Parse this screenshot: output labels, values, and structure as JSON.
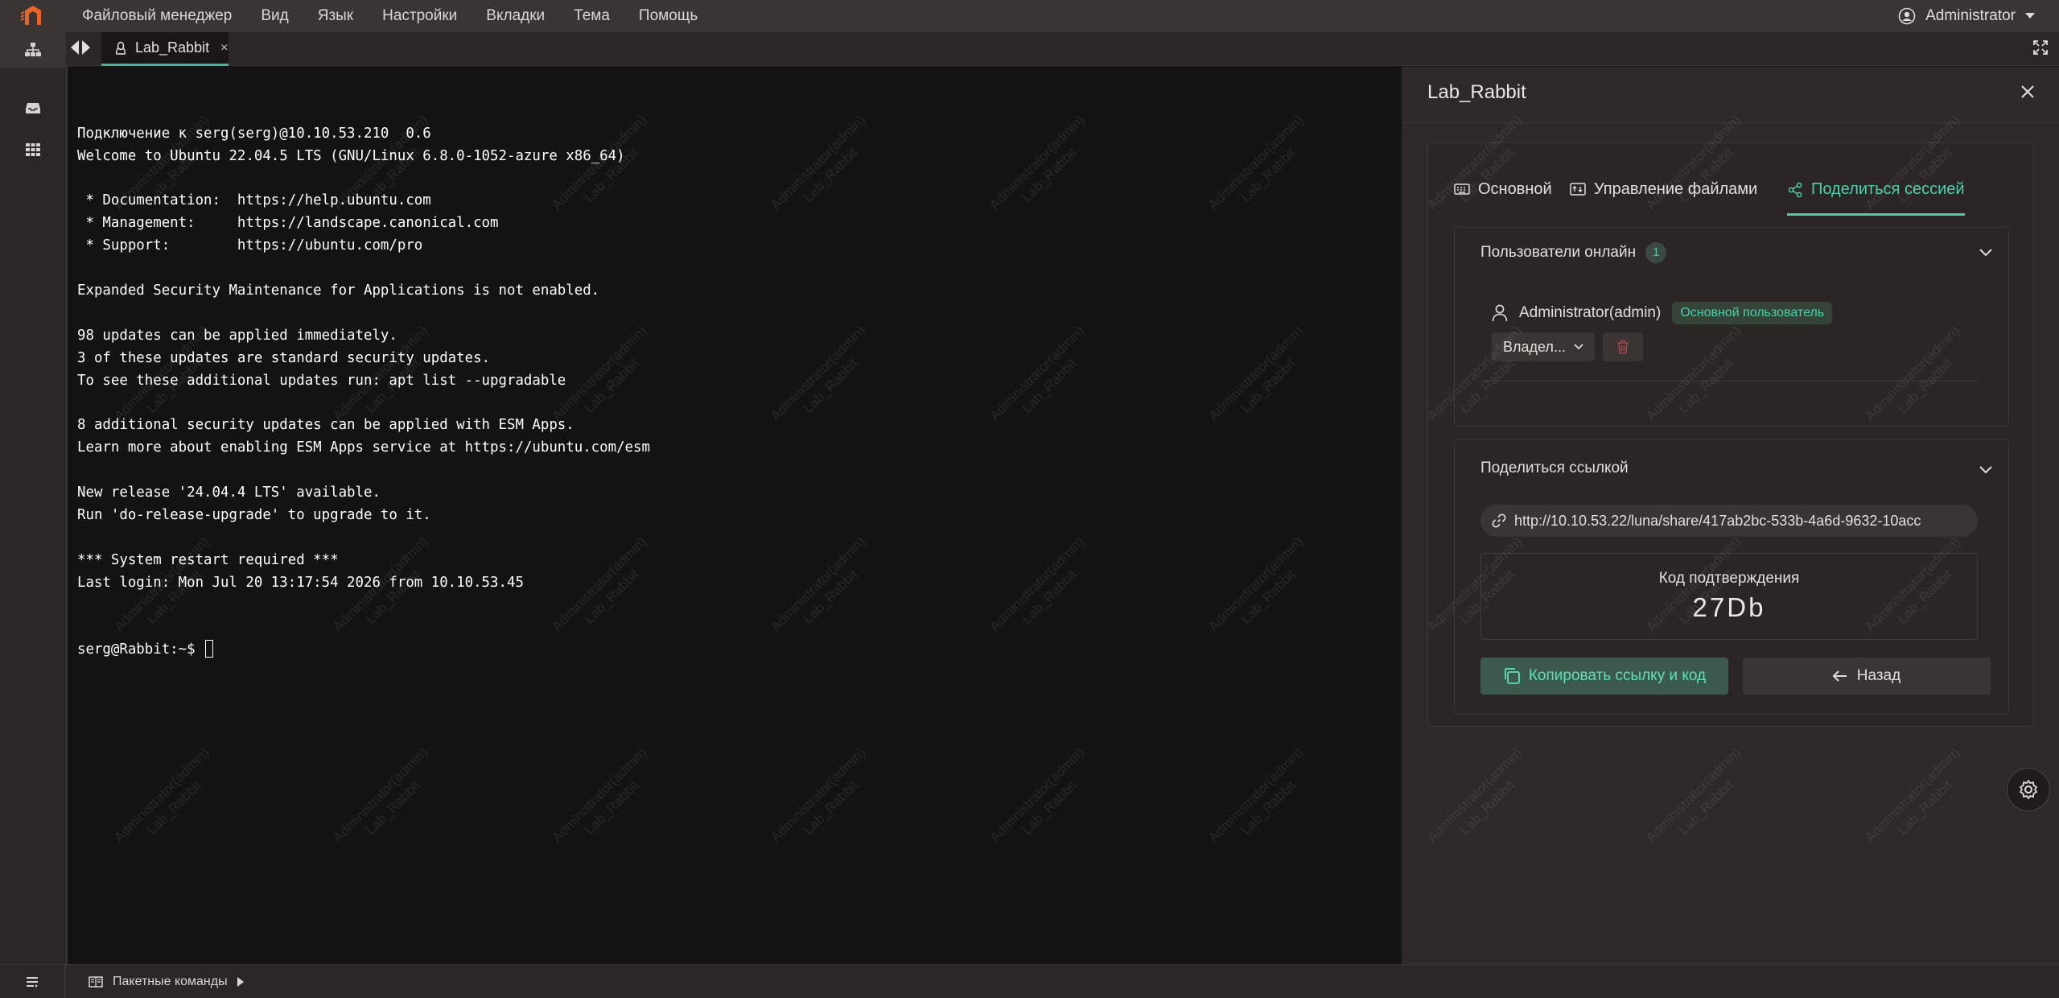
{
  "menu": {
    "items": [
      "Файловый менеджер",
      "Вид",
      "Язык",
      "Настройки",
      "Вкладки",
      "Тема",
      "Помощь"
    ],
    "user": "Administrator"
  },
  "tab": {
    "title": "Lab_Rabbit",
    "close": "×"
  },
  "terminal": {
    "lines": [
      "Подключение к serg(serg)@10.10.53.210  0.6",
      "Welcome to Ubuntu 22.04.5 LTS (GNU/Linux 6.8.0-1052-azure x86_64)",
      "",
      " * Documentation:  https://help.ubuntu.com",
      " * Management:     https://landscape.canonical.com",
      " * Support:        https://ubuntu.com/pro",
      "",
      "Expanded Security Maintenance for Applications is not enabled.",
      "",
      "98 updates can be applied immediately.",
      "3 of these updates are standard security updates.",
      "To see these additional updates run: apt list --upgradable",
      "",
      "8 additional security updates can be applied with ESM Apps.",
      "Learn more about enabling ESM Apps service at https://ubuntu.com/esm",
      "",
      "New release '24.04.4 LTS' available.",
      "Run 'do-release-upgrade' to upgrade to it.",
      "",
      "*** System restart required ***",
      "Last login: Mon Jul 20 13:17:54 2026 from 10.10.53.45"
    ],
    "prompt": "serg@Rabbit:~$ "
  },
  "watermark": {
    "line1": "Administrator(admin)",
    "line2": "Lab_Rabbit"
  },
  "panel": {
    "title": "Lab_Rabbit",
    "tabs": [
      "Основной",
      "Управление файлами",
      "Поделиться сессией"
    ],
    "online": {
      "title": "Пользователи онлайн",
      "count": "1",
      "user_name": "Administrator(admin)",
      "user_badge": "Основной пользователь",
      "role": "Владел..."
    },
    "share": {
      "title": "Поделиться ссылкой",
      "link": "http://10.10.53.22/luna/share/417ab2bc-533b-4a6d-9632-10acc",
      "code_label": "Код подтверждения",
      "code": "27Db",
      "copy_label": "Копировать ссылку и код",
      "back_label": "Назад"
    }
  },
  "bottom": {
    "batch_label": "Пакетные команды"
  },
  "colors": {
    "accent": "#4cd0ab",
    "menubar": "#3a3433",
    "terminal_bg": "#141313",
    "panel_bg": "#2e2928",
    "logo": "#e8652a"
  }
}
